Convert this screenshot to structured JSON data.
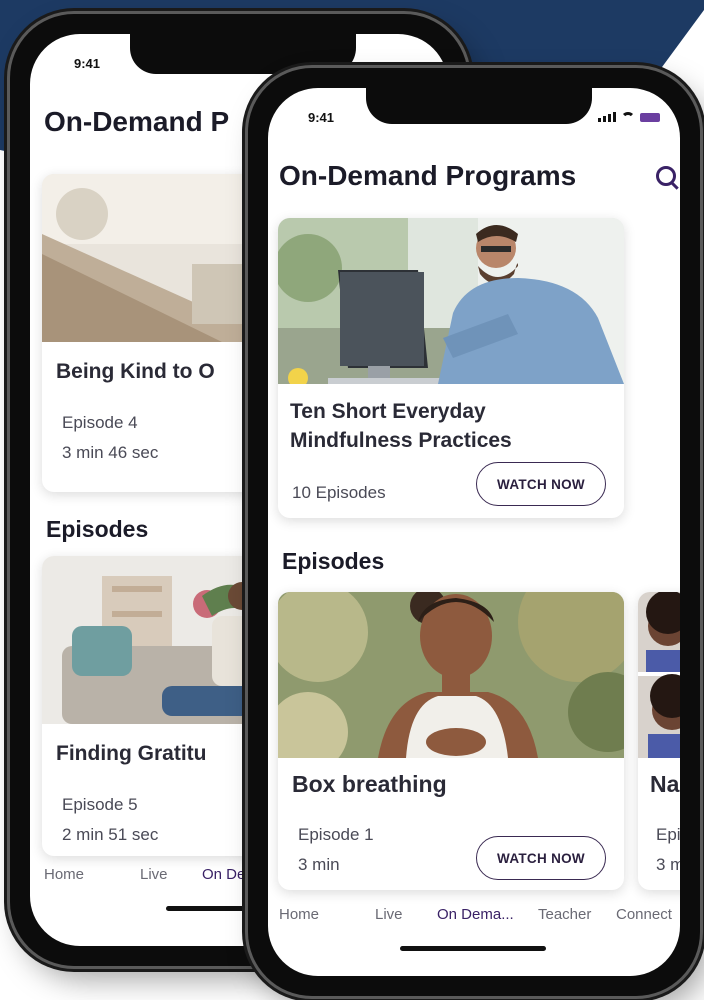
{
  "colors": {
    "background_band": "#1d3a63",
    "accent": "#3a2266",
    "battery": "#6b3fa0"
  },
  "back_phone": {
    "status": {
      "time": "9:41"
    },
    "title": "On-Demand P",
    "program": {
      "title": "Being Kind to O",
      "episode": "Episode 4",
      "duration": "3 min 46 sec"
    },
    "episodes_heading": "Episodes",
    "episode": {
      "title": "Finding Gratitu",
      "episode": "Episode 5",
      "duration": "2 min 51 sec"
    },
    "tabs": [
      "Home",
      "Live",
      "On De"
    ]
  },
  "front_phone": {
    "status": {
      "time": "9:41"
    },
    "title": "On-Demand Programs",
    "search_icon": "search-icon",
    "program": {
      "title_line1": "Ten Short Everyday",
      "title_line2": "Mindfulness Practices",
      "episodes_count": "10 Episodes",
      "button": "WATCH NOW"
    },
    "episodes_heading": "Episodes",
    "episode": {
      "title": "Box breathing",
      "episode": "Episode 1",
      "duration": "3 min",
      "button": "WATCH NOW"
    },
    "peek_card": {
      "title": "Na",
      "episode": "Epi",
      "duration": "3 m"
    },
    "tabs": [
      {
        "label": "Home",
        "active": false
      },
      {
        "label": "Live",
        "active": false
      },
      {
        "label": "On Dema...",
        "active": true
      },
      {
        "label": "Teacher",
        "active": false
      },
      {
        "label": "Connect",
        "active": false
      }
    ]
  }
}
